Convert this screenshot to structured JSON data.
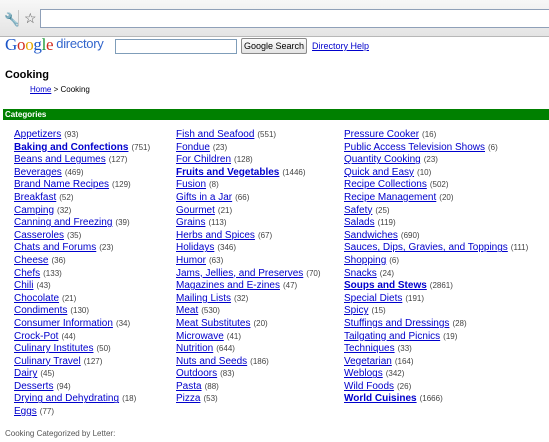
{
  "header": {
    "logo_letters": [
      "G",
      "o",
      "o",
      "g",
      "l",
      "e"
    ],
    "logo_suffix": "directory",
    "search_button": "Google Search",
    "help_link": "Directory Help"
  },
  "page": {
    "title": "Cooking",
    "breadcrumb": {
      "home": "Home",
      "separator": ">",
      "current": "Cooking"
    },
    "categories_header": "Categories",
    "footer": "Cooking Categorized by Letter:"
  },
  "columns": [
    [
      {
        "label": "Appetizers",
        "count": "(93)",
        "bold": false
      },
      {
        "label": "Baking and Confections",
        "count": "(751)",
        "bold": true
      },
      {
        "label": "Beans and Legumes",
        "count": "(127)",
        "bold": false
      },
      {
        "label": "Beverages",
        "count": "(469)",
        "bold": false
      },
      {
        "label": "Brand Name Recipes",
        "count": "(129)",
        "bold": false
      },
      {
        "label": "Breakfast",
        "count": "(52)",
        "bold": false
      },
      {
        "label": "Camping",
        "count": "(32)",
        "bold": false
      },
      {
        "label": "Canning and Freezing",
        "count": "(39)",
        "bold": false
      },
      {
        "label": "Casseroles",
        "count": "(35)",
        "bold": false
      },
      {
        "label": "Chats and Forums",
        "count": "(23)",
        "bold": false
      },
      {
        "label": "Cheese",
        "count": "(36)",
        "bold": false
      },
      {
        "label": "Chefs",
        "count": "(133)",
        "bold": false
      },
      {
        "label": "Chili",
        "count": "(43)",
        "bold": false
      },
      {
        "label": "Chocolate",
        "count": "(21)",
        "bold": false
      },
      {
        "label": "Condiments",
        "count": "(130)",
        "bold": false
      },
      {
        "label": "Consumer Information",
        "count": "(34)",
        "bold": false
      },
      {
        "label": "Crock-Pot",
        "count": "(44)",
        "bold": false
      },
      {
        "label": "Culinary Institutes",
        "count": "(50)",
        "bold": false
      },
      {
        "label": "Culinary Travel",
        "count": "(127)",
        "bold": false
      },
      {
        "label": "Dairy",
        "count": "(45)",
        "bold": false
      },
      {
        "label": "Desserts",
        "count": "(94)",
        "bold": false
      },
      {
        "label": "Drying and Dehydrating",
        "count": "(18)",
        "bold": false
      },
      {
        "label": "Eggs",
        "count": "(77)",
        "bold": false
      }
    ],
    [
      {
        "label": "Fish and Seafood",
        "count": "(551)",
        "bold": false
      },
      {
        "label": "Fondue",
        "count": "(23)",
        "bold": false
      },
      {
        "label": "For Children",
        "count": "(128)",
        "bold": false
      },
      {
        "label": "Fruits and Vegetables",
        "count": "(1446)",
        "bold": true
      },
      {
        "label": "Fusion",
        "count": "(8)",
        "bold": false
      },
      {
        "label": "Gifts in a Jar",
        "count": "(66)",
        "bold": false
      },
      {
        "label": "Gourmet",
        "count": "(21)",
        "bold": false
      },
      {
        "label": "Grains",
        "count": "(113)",
        "bold": false
      },
      {
        "label": "Herbs and Spices",
        "count": "(67)",
        "bold": false
      },
      {
        "label": "Holidays",
        "count": "(346)",
        "bold": false
      },
      {
        "label": "Humor",
        "count": "(63)",
        "bold": false
      },
      {
        "label": "Jams, Jellies, and Preserves",
        "count": "(70)",
        "bold": false
      },
      {
        "label": "Magazines and E-zines",
        "count": "(47)",
        "bold": false
      },
      {
        "label": "Mailing Lists",
        "count": "(32)",
        "bold": false
      },
      {
        "label": "Meat",
        "count": "(530)",
        "bold": false
      },
      {
        "label": "Meat Substitutes",
        "count": "(20)",
        "bold": false
      },
      {
        "label": "Microwave",
        "count": "(41)",
        "bold": false
      },
      {
        "label": "Nutrition",
        "count": "(644)",
        "bold": false
      },
      {
        "label": "Nuts and Seeds",
        "count": "(186)",
        "bold": false
      },
      {
        "label": "Outdoors",
        "count": "(83)",
        "bold": false
      },
      {
        "label": "Pasta",
        "count": "(88)",
        "bold": false
      },
      {
        "label": "Pizza",
        "count": "(53)",
        "bold": false
      }
    ],
    [
      {
        "label": "Pressure Cooker",
        "count": "(16)",
        "bold": false
      },
      {
        "label": "Public Access Television Shows",
        "count": "(6)",
        "bold": false
      },
      {
        "label": "Quantity Cooking",
        "count": "(23)",
        "bold": false
      },
      {
        "label": "Quick and Easy",
        "count": "(10)",
        "bold": false
      },
      {
        "label": "Recipe Collections",
        "count": "(502)",
        "bold": false
      },
      {
        "label": "Recipe Management",
        "count": "(20)",
        "bold": false
      },
      {
        "label": "Safety",
        "count": "(25)",
        "bold": false
      },
      {
        "label": "Salads",
        "count": "(119)",
        "bold": false
      },
      {
        "label": "Sandwiches",
        "count": "(690)",
        "bold": false
      },
      {
        "label": "Sauces, Dips, Gravies, and Toppings",
        "count": "(111)",
        "bold": false
      },
      {
        "label": "Shopping",
        "count": "(6)",
        "bold": false
      },
      {
        "label": "Snacks",
        "count": "(24)",
        "bold": false
      },
      {
        "label": "Soups and Stews",
        "count": "(2861)",
        "bold": true
      },
      {
        "label": "Special Diets",
        "count": "(191)",
        "bold": false
      },
      {
        "label": "Spicy",
        "count": "(15)",
        "bold": false
      },
      {
        "label": "Stuffings and Dressings",
        "count": "(28)",
        "bold": false
      },
      {
        "label": "Tailgating and Picnics",
        "count": "(19)",
        "bold": false
      },
      {
        "label": "Techniques",
        "count": "(33)",
        "bold": false
      },
      {
        "label": "Vegetarian",
        "count": "(164)",
        "bold": false
      },
      {
        "label": "Weblogs",
        "count": "(342)",
        "bold": false
      },
      {
        "label": "Wild Foods",
        "count": "(26)",
        "bold": false
      },
      {
        "label": "World Cuisines",
        "count": "(1666)",
        "bold": true
      }
    ]
  ]
}
